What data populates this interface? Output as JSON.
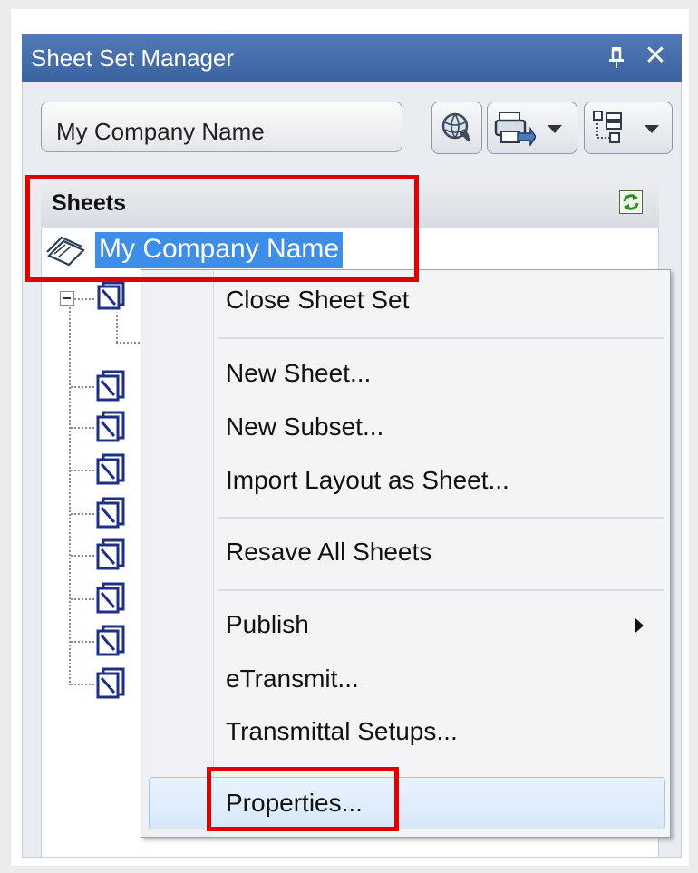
{
  "panel": {
    "title": "Sheet Set Manager",
    "pin_glyph": "Ԅ",
    "close_glyph": "✕"
  },
  "toolbar": {
    "sheet_set_selector": "My Company Name",
    "buttons": [
      {
        "name": "globe-search-button",
        "icon": "globe-magnifier-icon"
      },
      {
        "name": "publish-button",
        "icon": "publish-icon",
        "has_dropdown": true
      },
      {
        "name": "view-options-button",
        "icon": "tree-view-icon",
        "has_dropdown": true
      }
    ]
  },
  "tree": {
    "header_label": "Sheets",
    "root_label": "My Company Name",
    "selection_color": "#3d8ee8"
  },
  "context_menu": {
    "groups": [
      [
        "Close Sheet Set"
      ],
      [
        "New Sheet...",
        "New Subset...",
        "Import Layout as Sheet..."
      ],
      [
        "Resave All Sheets"
      ],
      [
        "Publish",
        "eTransmit...",
        "Transmittal Setups...",
        "Properties..."
      ]
    ],
    "hovered_item": "Properties...",
    "submenu_item": "Publish"
  },
  "colors": {
    "titlebar": "#3b63a1",
    "highlight_box": "#e00000",
    "menu_hover": "#d7e8fa"
  }
}
